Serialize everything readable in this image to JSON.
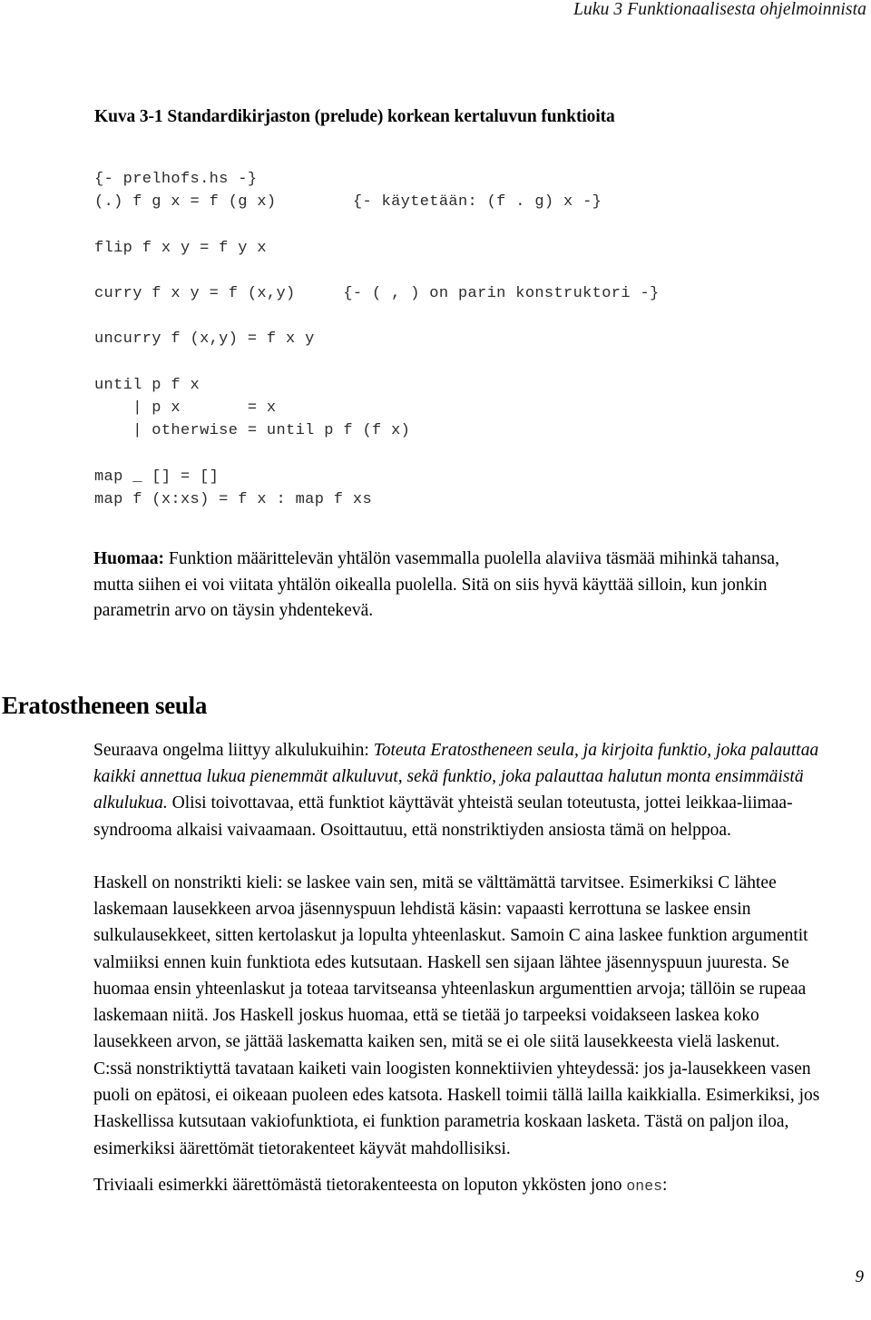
{
  "header": {
    "running_title": "Luku 3 Funktionaalisesta ohjelmoinnista"
  },
  "figure": {
    "caption": "Kuva 3-1 Standardikirjaston (prelude) korkean kertaluvun funktioita",
    "code_lines": [
      "{- prelhofs.hs -}",
      "(.) f g x = f (g x)        {- käytetään: (f . g) x -}",
      "",
      "flip f x y = f y x",
      "",
      "curry f x y = f (x,y)     {- ( , ) on parin konstruktori -}",
      "",
      "uncurry f (x,y) = f x y",
      "",
      "until p f x",
      "    | p x       = x",
      "    | otherwise = until p f (f x)",
      "",
      "map _ [] = []",
      "map f (x:xs) = f x : map f xs"
    ],
    "code_text": "{- prelhofs.hs -}\n(.) f g x = f (g x)        {- käytetään: (f . g) x -}\n\nflip f x y = f y x\n\ncurry f x y = f (x,y)     {- ( , ) on parin konstruktori -}\n\nuncurry f (x,y) = f x y\n\nuntil p f x\n    | p x       = x\n    | otherwise = until p f (f x)\n\nmap _ [] = []\nmap f (x:xs) = f x : map f xs"
  },
  "note": {
    "label": "Huomaa:",
    "text": " Funktion määrittelevän yhtälön vasemmalla puolella alaviiva täsmää mihinkä tahansa, mutta siihen ei voi viitata yhtälön oikealla puolella. Sitä on siis hyvä käyttää silloin, kun jonkin parametrin arvo on täysin yhdentekevä."
  },
  "section": {
    "heading": "Eratostheneen seula"
  },
  "paragraphs": {
    "p1_lead": "Seuraava ongelma liittyy alkulukuihin: ",
    "p1_italic": "Toteuta Eratostheneen seula, ja kirjoita funktio, joka palauttaa kaikki annettua lukua pienemmät alkuluvut, sekä funktio, joka palauttaa halutun monta ensimmäistä alkulukua.",
    "p1_tail": " Olisi toivottavaa, että funktiot käyttävät yhteistä seulan toteutusta, jottei leikkaa-liimaa-syndrooma alkaisi vaivaamaan. Osoittautuu, että nonstriktiyden ansiosta tämä on helppoa.",
    "p2": "Haskell on nonstrikti kieli: se laskee vain sen, mitä se välttämättä tarvitsee. Esimerkiksi C lähtee laskemaan lausekkeen arvoa jäsennyspuun lehdistä käsin: vapaasti kerrottuna se laskee ensin sulkulausekkeet, sitten kertolaskut ja lopulta yhteenlaskut. Samoin C aina laskee funktion argumentit valmiiksi ennen kuin funktiota edes kutsutaan. Haskell sen sijaan lähtee jäsennyspuun juuresta. Se huomaa ensin yhteenlaskut ja toteaa tarvitseansa yhteenlaskun argumenttien arvoja; tällöin se rupeaa laskemaan niitä. Jos Haskell joskus huomaa, että se tietää jo tarpeeksi voidakseen laskea koko lausekkeen arvon, se jättää laskematta kaiken sen, mitä se ei ole siitä lausekkeesta vielä laskenut.",
    "p3": "C:ssä nonstriktiyttä tavataan kaiketi vain loogisten konnektiivien yhteydessä: jos ja-lausekkeen vasen puoli on epätosi, ei oikeaan puoleen edes katsota. Haskell toimii tällä lailla kaikkialla. Esimerkiksi, jos Haskellissa kutsutaan vakiofunktiota, ei funktion parametria koskaan lasketa. Tästä on paljon iloa, esimerkiksi äärettömät tietorakenteet käyvät mahdollisiksi.",
    "p4_lead": "Triviaali esimerkki äärettömästä tietorakenteesta on loputon ykkösten jono ",
    "p4_mono": "ones",
    "p4_tail": ":"
  },
  "footer": {
    "page_number": "9"
  }
}
